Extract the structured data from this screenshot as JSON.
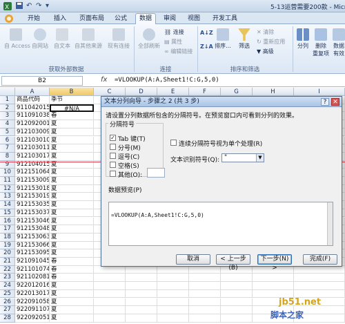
{
  "window": {
    "title": "5-13运营需要200款 - Micro"
  },
  "tabs": [
    "开始",
    "插入",
    "页面布局",
    "公式",
    "数据",
    "审阅",
    "视图",
    "开发工具"
  ],
  "active_tab": "数据",
  "ribbon": {
    "external": {
      "access": "自 Access",
      "web": "自网站",
      "text": "自文本",
      "other": "自其他来源",
      "existing": "现有连接",
      "label": "获取外部数据"
    },
    "connections": {
      "refresh_all": "全部刷新",
      "conn": "连接",
      "props": "属性",
      "edit_links": "编辑链接",
      "label": "连接"
    },
    "sort": {
      "asc": "A↓Z",
      "desc": "Z↓A",
      "sort": "排序...",
      "filter": "筛选",
      "clear": "清除",
      "reapply": "重新应用",
      "advanced": "高级",
      "label": "排序和筛选"
    },
    "tools": {
      "split": "分列",
      "remove_dup_1": "删除",
      "remove_dup_2": "重复项",
      "validation_1": "数据",
      "validation_2": "有效"
    }
  },
  "formula_bar": {
    "name_box": "B2",
    "fx": "fx",
    "formula": "=VLOOKUP(A:A,Sheet1!C:G,5,0)"
  },
  "columns": [
    "A",
    "B",
    "C",
    "D",
    "E",
    "F",
    "G",
    "H",
    "I"
  ],
  "rows": [
    {
      "n": "1",
      "a": "商品代码",
      "b": "季节"
    },
    {
      "n": "2",
      "a": "911042015",
      "b": "#N/A"
    },
    {
      "n": "3",
      "a": "911091038",
      "b": "春"
    },
    {
      "n": "4",
      "a": "912092001",
      "b": "夏"
    },
    {
      "n": "5",
      "a": "912103009",
      "b": "夏"
    },
    {
      "n": "6",
      "a": "912103010",
      "b": "夏"
    },
    {
      "n": "7",
      "a": "912103011",
      "b": "夏"
    },
    {
      "n": "8",
      "a": "912103017",
      "b": "夏"
    },
    {
      "n": "9",
      "a": "912104015",
      "b": "夏"
    },
    {
      "n": "10",
      "a": "912151064",
      "b": "夏"
    },
    {
      "n": "11",
      "a": "912153009",
      "b": "夏"
    },
    {
      "n": "12",
      "a": "912153018",
      "b": "夏"
    },
    {
      "n": "13",
      "a": "912153019",
      "b": "夏"
    },
    {
      "n": "14",
      "a": "912153035",
      "b": "夏"
    },
    {
      "n": "15",
      "a": "912153037",
      "b": "夏"
    },
    {
      "n": "16",
      "a": "912153046",
      "b": "夏"
    },
    {
      "n": "17",
      "a": "912153048",
      "b": "夏"
    },
    {
      "n": "18",
      "a": "912153063",
      "b": "夏"
    },
    {
      "n": "19",
      "a": "912153066",
      "b": "夏"
    },
    {
      "n": "20",
      "a": "912153095",
      "b": "夏"
    },
    {
      "n": "21",
      "a": "921091045",
      "b": "春"
    },
    {
      "n": "22",
      "a": "921101074",
      "b": "春"
    },
    {
      "n": "23",
      "a": "921102081",
      "b": "春"
    },
    {
      "n": "24",
      "a": "922012016",
      "b": "夏"
    },
    {
      "n": "25",
      "a": "922013017",
      "b": "夏"
    },
    {
      "n": "26",
      "a": "922091058",
      "b": "夏"
    },
    {
      "n": "27",
      "a": "922091107",
      "b": "夏"
    },
    {
      "n": "28",
      "a": "922092051",
      "b": "夏"
    }
  ],
  "dialog": {
    "title": "文本分列向导 - 步骤之 2 (共 3 步)",
    "instructions": "请设置分列数据所包含的分隔符号。在预览窗口内可看到分列的效果。",
    "delims_label": "分隔符号",
    "tab": "Tab 键(T)",
    "semicolon": "分号(M)",
    "comma": "逗号(C)",
    "space": "空格(S)",
    "other": "其他(O):",
    "consecutive": "连续分隔符号视为单个处理(R)",
    "qualifier_label": "文本识别符号(Q):",
    "qualifier_value": "\"",
    "preview_label": "数据预览(P)",
    "preview_text": "=VLOOKUP(A:A,Sheet1!C:G,5,0)",
    "cancel": "取消",
    "back": "< 上一步(B)",
    "next": "下一步(N) >",
    "finish": "完成(F)"
  },
  "watermark": {
    "line1": "jb51.net",
    "line2": "脚本之家"
  }
}
